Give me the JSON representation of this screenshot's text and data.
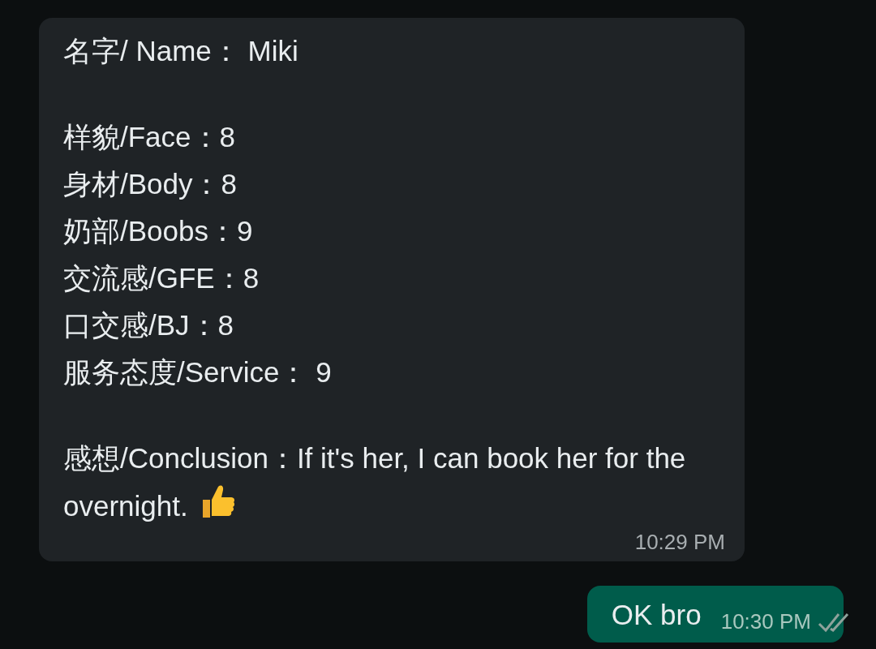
{
  "messages": [
    {
      "kind": "incoming",
      "paragraphs": [
        [
          "名字/ Name： Miki"
        ],
        [
          "样貌/Face：8",
          "身材/Body：8",
          "奶部/Boobs：9",
          "交流感/GFE：8",
          "口交感/BJ：8",
          "服务态度/Service： 9"
        ],
        [
          "感想/Conclusion：If it's her, I can book her for the overnight."
        ]
      ],
      "emoji_end": true,
      "time": "10:29 PM"
    },
    {
      "kind": "outgoing",
      "paragraphs": [
        [
          "OK bro"
        ]
      ],
      "emoji_end": false,
      "time": "10:30 PM",
      "read": false
    }
  ]
}
